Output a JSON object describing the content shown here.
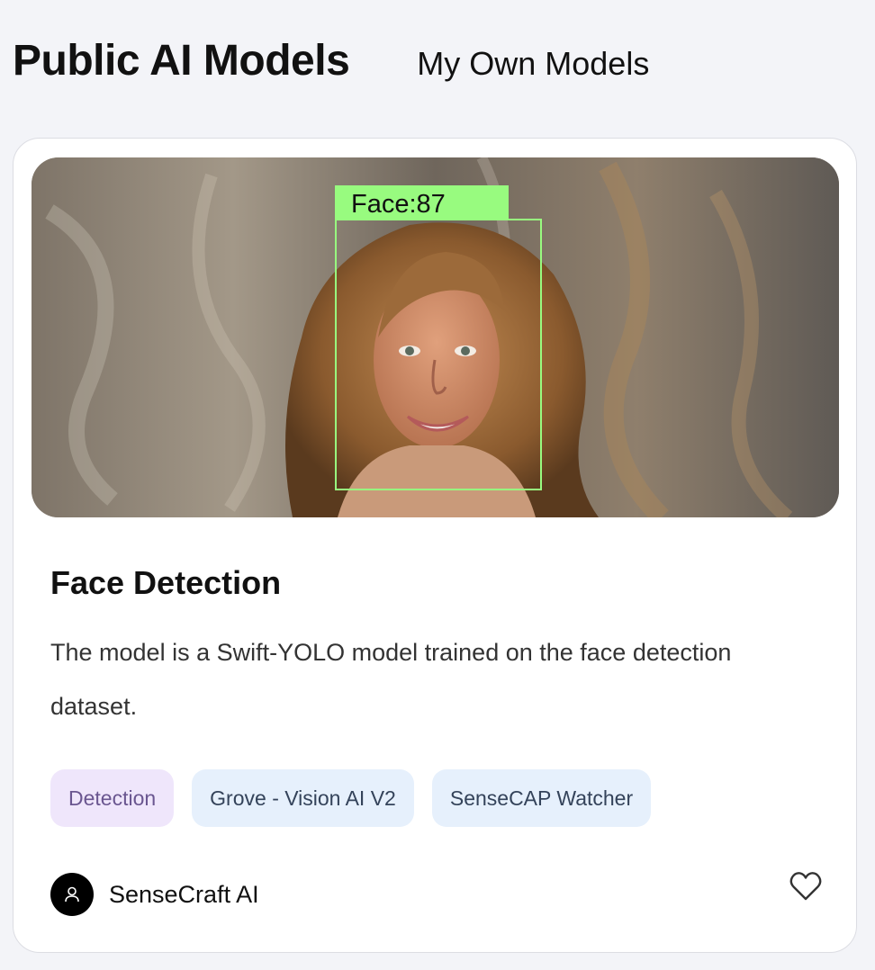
{
  "tabs": {
    "active": "Public AI Models",
    "inactive": "My Own Models"
  },
  "card": {
    "image": {
      "detection_label": "Face:87",
      "box_color": "#98fb7f"
    },
    "title": "Face Detection",
    "description": "The model is a Swift-YOLO model trained on the face detection dataset.",
    "tags": [
      {
        "label": "Detection",
        "kind": "task"
      },
      {
        "label": "Grove - Vision AI V2",
        "kind": "device"
      },
      {
        "label": "SenseCAP Watcher",
        "kind": "device"
      }
    ],
    "author": {
      "name": "SenseCraft AI",
      "icon": "user-icon"
    },
    "favorite_icon": "heart-icon"
  }
}
